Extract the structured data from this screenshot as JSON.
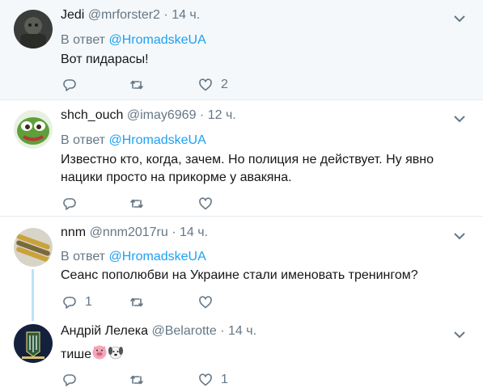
{
  "tweets": [
    {
      "fullname": "Jedi",
      "handle": "@mrforster2",
      "time": "14 ч.",
      "reply_prefix": "В ответ",
      "reply_mention": "@HromadskeUA",
      "text": "Вот пидарасы!",
      "replies": "",
      "retweets": "",
      "likes": "2"
    },
    {
      "fullname": "shch_ouch",
      "handle": "@imay6969",
      "time": "12 ч.",
      "reply_prefix": "В ответ",
      "reply_mention": "@HromadskeUA",
      "text": "Известно кто, когда, зачем. Но полиция не действует. Ну явно нацики просто на прикорме у авакяна.",
      "replies": "",
      "retweets": "",
      "likes": ""
    },
    {
      "fullname": "nnm",
      "handle": "@nnm2017ru",
      "time": "14 ч.",
      "reply_prefix": "В ответ",
      "reply_mention": "@HromadskeUA",
      "text": "Сеанс пополюбви на Украине стали именовать тренингом?",
      "replies": "1",
      "retweets": "",
      "likes": ""
    },
    {
      "fullname": "Андрій Лелека",
      "handle": "@Belarotte",
      "time": "14 ч.",
      "text": "тише",
      "emoji": [
        "pig-face",
        "dog-face"
      ],
      "replies": "",
      "retweets": "",
      "likes": "1"
    }
  ],
  "separator": "·",
  "colors": {
    "accent": "#1da1f2",
    "muted": "#657786",
    "highlight_bg": "#f5f8fa",
    "thread_line": "#bbe3fb"
  }
}
